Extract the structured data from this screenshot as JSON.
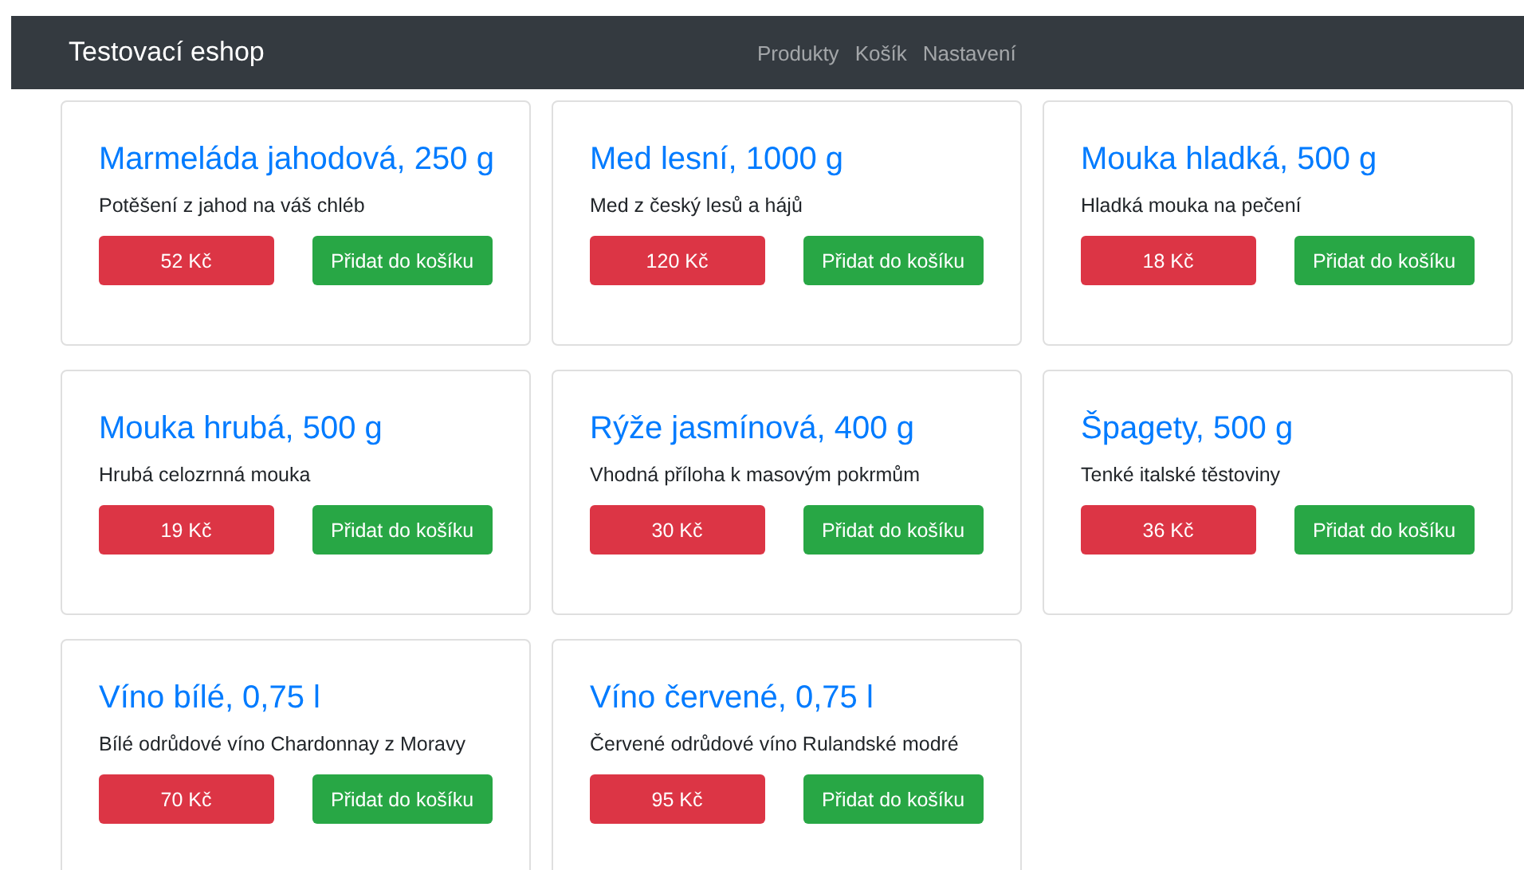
{
  "navbar": {
    "brand": "Testovací eshop",
    "links": [
      {
        "label": "Produkty"
      },
      {
        "label": "Košík"
      },
      {
        "label": "Nastavení"
      }
    ]
  },
  "products": [
    {
      "name": "Marmeláda jahodová, 250 g",
      "description": "Potěšení z jahod na váš chléb",
      "price": "52 Kč",
      "button": "Přidat do košíku"
    },
    {
      "name": "Med lesní, 1000 g",
      "description": "Med z český lesů a hájů",
      "price": "120 Kč",
      "button": "Přidat do košíku"
    },
    {
      "name": "Mouka hladká, 500 g",
      "description": "Hladká mouka na pečení",
      "price": "18 Kč",
      "button": "Přidat do košíku"
    },
    {
      "name": "Mouka hrubá, 500 g",
      "description": "Hrubá celozrnná mouka",
      "price": "19 Kč",
      "button": "Přidat do košíku"
    },
    {
      "name": "Rýže jasmínová, 400 g",
      "description": "Vhodná příloha k masovým pokrmům",
      "price": "30 Kč",
      "button": "Přidat do košíku"
    },
    {
      "name": "Špagety, 500 g",
      "description": "Tenké italské těstoviny",
      "price": "36 Kč",
      "button": "Přidat do košíku"
    },
    {
      "name": "Víno bílé, 0,75 l",
      "description": "Bílé odrůdové víno Chardonnay z Moravy",
      "price": "70 Kč",
      "button": "Přidat do košíku"
    },
    {
      "name": "Víno červené, 0,75 l",
      "description": "Červené odrůdové víno Rulandské modré",
      "price": "95 Kč",
      "button": "Přidat do košíku"
    }
  ]
}
